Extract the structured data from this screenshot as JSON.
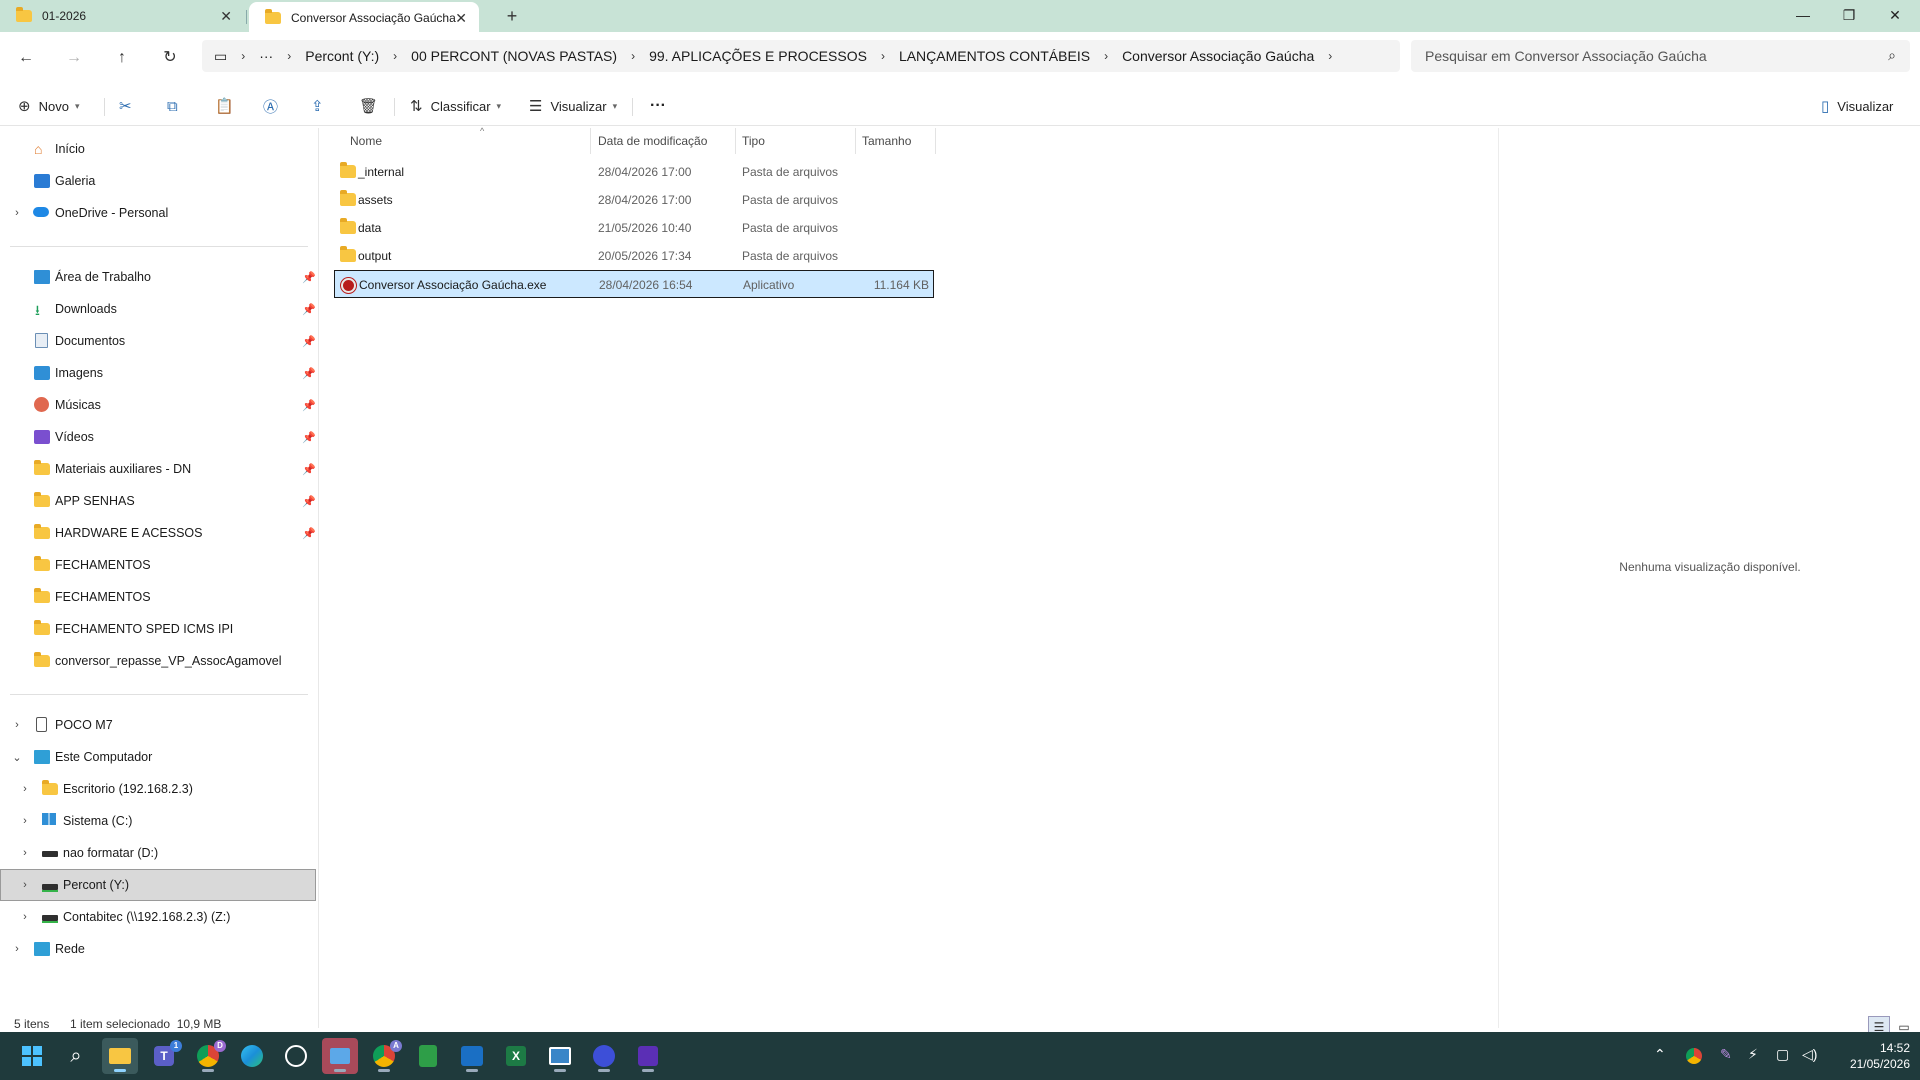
{
  "window": {
    "tabs": [
      {
        "label": "01-2026",
        "active": false
      },
      {
        "label": "Conversor Associação Gaúcha",
        "active": true
      }
    ],
    "new_tab_icon": "plus-icon",
    "controls": [
      "minimize-icon",
      "maximize-icon",
      "close-icon"
    ]
  },
  "address": {
    "breadcrumbs": [
      "Percont (Y:)",
      "00 PERCONT (NOVAS PASTAS)",
      "99. APLICAÇÕES E PROCESSOS",
      "LANÇAMENTOS CONTÁBEIS",
      "Conversor Associação Gaúcha"
    ],
    "overflow": "···",
    "search_placeholder": "Pesquisar em Conversor Associação Gaúcha"
  },
  "commandbar": {
    "new_label": "Novo",
    "sort_label": "Classificar",
    "view_label": "Visualizar",
    "more": "···",
    "details_label": "Visualizar"
  },
  "sidebar": {
    "quick": [
      {
        "label": "Início",
        "icon": "home-icon"
      },
      {
        "label": "Galeria",
        "icon": "gallery-icon"
      },
      {
        "label": "OneDrive - Personal",
        "icon": "cloud-icon"
      }
    ],
    "pinned": [
      {
        "label": "Área de Trabalho",
        "icon": "desktop-icon",
        "pinned": true
      },
      {
        "label": "Downloads",
        "icon": "download-icon",
        "pinned": true
      },
      {
        "label": "Documentos",
        "icon": "document-icon",
        "pinned": true
      },
      {
        "label": "Imagens",
        "icon": "image-icon",
        "pinned": true
      },
      {
        "label": "Músicas",
        "icon": "music-icon",
        "pinned": true
      },
      {
        "label": "Vídeos",
        "icon": "video-icon",
        "pinned": true
      },
      {
        "label": "Materiais auxiliares - DN",
        "icon": "folder-icon",
        "pinned": true
      },
      {
        "label": "APP SENHAS",
        "icon": "folder-icon",
        "pinned": true
      },
      {
        "label": "HARDWARE E ACESSOS",
        "icon": "folder-icon",
        "pinned": true
      },
      {
        "label": "FECHAMENTOS",
        "icon": "folder-icon",
        "pinned": false
      },
      {
        "label": "FECHAMENTOS",
        "icon": "folder-icon",
        "pinned": false
      },
      {
        "label": "FECHAMENTO SPED ICMS IPI",
        "icon": "folder-icon",
        "pinned": false
      },
      {
        "label": "conversor_repasse_VP_AssocAgamovel",
        "icon": "folder-icon",
        "pinned": false
      }
    ],
    "devices": [
      {
        "label": "POCO M7",
        "icon": "phone-icon"
      },
      {
        "label": "Este Computador",
        "icon": "computer-icon"
      },
      {
        "label": "Escritorio (192.168.2.3)",
        "icon": "network-folder-icon"
      },
      {
        "label": "Sistema (C:)",
        "icon": "windows-drive-icon"
      },
      {
        "label": "nao formatar (D:)",
        "icon": "drive-icon"
      },
      {
        "label": "Percont (Y:)",
        "icon": "network-drive-icon"
      },
      {
        "label": "Contabitec (\\\\192.168.2.3) (Z:)",
        "icon": "network-drive-icon"
      },
      {
        "label": "Rede",
        "icon": "network-icon"
      }
    ]
  },
  "filelist": {
    "columns": [
      "Nome",
      "Data de modificação",
      "Tipo",
      "Tamanho"
    ],
    "rows": [
      {
        "name": "_internal",
        "date": "28/04/2026 17:00",
        "type": "Pasta de arquivos",
        "size": "",
        "icon": "folder-icon"
      },
      {
        "name": "assets",
        "date": "28/04/2026 17:00",
        "type": "Pasta de arquivos",
        "size": "",
        "icon": "folder-icon"
      },
      {
        "name": "data",
        "date": "21/05/2026 10:40",
        "type": "Pasta de arquivos",
        "size": "",
        "icon": "folder-icon"
      },
      {
        "name": "output",
        "date": "20/05/2026 17:34",
        "type": "Pasta de arquivos",
        "size": "",
        "icon": "folder-icon"
      },
      {
        "name": "Conversor Associação Gaúcha.exe",
        "date": "28/04/2026 16:54",
        "type": "Aplicativo",
        "size": "11.164 KB",
        "icon": "app-icon",
        "selected": true
      }
    ]
  },
  "preview": {
    "message": "Nenhuma visualização disponível."
  },
  "status": {
    "count": "5 itens",
    "selection": "1 item selecionado  10,9 MB"
  },
  "taskbar": {
    "apps": [
      "start-icon",
      "search-icon",
      "file-explorer-icon",
      "teams-icon",
      "chrome-icon",
      "edge-icon",
      "whatsapp-icon",
      "remote-desktop-icon",
      "chrome-profile-icon",
      "calculator-icon",
      "outlook-icon",
      "excel-icon",
      "app-icon",
      "discord-icon",
      "app-icon"
    ],
    "badge_teams": "1",
    "badge_chrome": "D",
    "badge_chrome2": "A",
    "time": "14:52",
    "date": "21/05/2026"
  }
}
